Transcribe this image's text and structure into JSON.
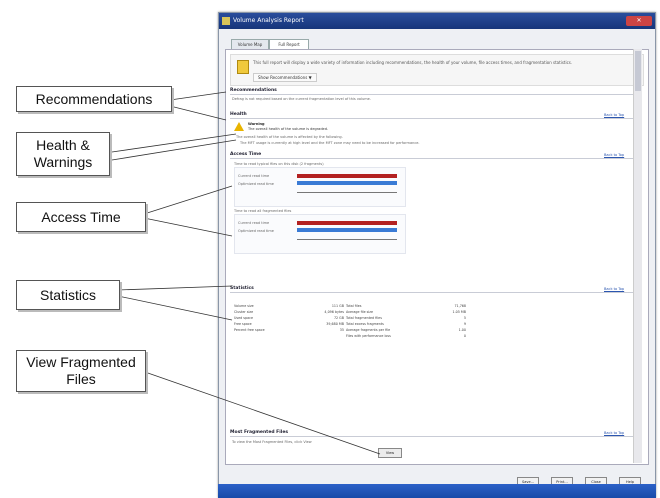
{
  "window": {
    "title": "Volume Analysis Report",
    "controls": "✕"
  },
  "tabs": [
    {
      "label": "Volume Map"
    },
    {
      "label": "Full Report"
    }
  ],
  "intro": {
    "text": "This full report will display a wide variety of information including recommendations, the health of your volume, file access times, and fragmentation statistics.",
    "show_recommendations": "Show Recommendations ▼"
  },
  "sections": {
    "recommendations": {
      "title": "Recommendations",
      "text": "Defrag is not required based on the current fragmentation level of this volume."
    },
    "health": {
      "title": "Health",
      "warning_title": "Warning",
      "warning_line": "The overall health of the volume is degraded.",
      "detail": "The overall health of the volume is affected by the following.",
      "item": "The MFT usage is currently at high level and the MFT zone may need to be increased for performance."
    },
    "access": {
      "title": "Access Time",
      "chart1_label": "Time to read typical files on this disk (2 fragments)",
      "chart2_label": "Time to read all fragmented files",
      "legend_current": "Current read time",
      "legend_optimal": "Optimized read time"
    },
    "stats": {
      "title": "Statistics"
    },
    "frag_files": {
      "title": "Most Fragmented Files",
      "text": "To view the Most Fragmented Files, click View",
      "button": "View"
    }
  },
  "links": {
    "back_to_top": "Back to Top"
  },
  "stats_left": [
    {
      "label": "Volume size",
      "value": "111 GB"
    },
    {
      "label": "Cluster size",
      "value": "4,096 bytes"
    },
    {
      "label": "Used space",
      "value": "72 GB"
    },
    {
      "label": "Free space",
      "value": "39,680 MB"
    },
    {
      "label": "Percent free space",
      "value": "35"
    }
  ],
  "stats_right": [
    {
      "label": "Total files",
      "value": "71,768"
    },
    {
      "label": "Average file size",
      "value": "1.05 MB"
    },
    {
      "label": "Total fragmented files",
      "value": "5"
    },
    {
      "label": "Total excess fragments",
      "value": "9"
    },
    {
      "label": "Average fragments per file",
      "value": "1.00"
    },
    {
      "label": "Files with performance loss",
      "value": "0"
    }
  ],
  "callouts": {
    "recommendations": "Recommendations",
    "health": "Health & Warnings",
    "access": "Access Time",
    "statistics": "Statistics",
    "view": "View Fragmented Files"
  },
  "buttons": [
    "Save...",
    "Print...",
    "Close",
    "Help"
  ],
  "chart_data": [
    {
      "type": "bar",
      "categories": [
        "Current read time",
        "Optimized read time"
      ],
      "values": [
        100,
        100
      ],
      "xlim": [
        0,
        100
      ]
    },
    {
      "type": "bar",
      "categories": [
        "Current read time",
        "Optimized read time"
      ],
      "values": [
        100,
        100
      ],
      "xlim": [
        0,
        100
      ]
    }
  ],
  "colors": {
    "current": "#b32121",
    "optimized": "#3a7bd5",
    "titlebar": "#1f4590",
    "taskbar": "#1f56bd"
  }
}
